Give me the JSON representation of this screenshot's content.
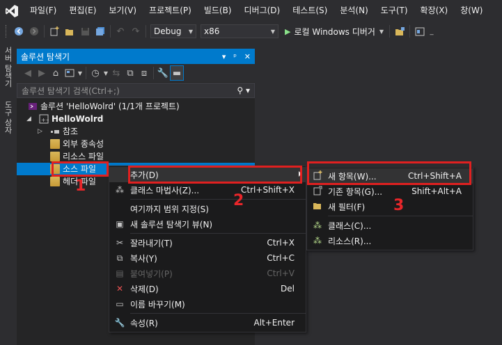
{
  "menubar": {
    "items": [
      "파일(F)",
      "편집(E)",
      "보기(V)",
      "프로젝트(P)",
      "빌드(B)",
      "디버그(D)",
      "테스트(S)",
      "분석(N)",
      "도구(T)",
      "확장(X)",
      "창(W)"
    ]
  },
  "toolbar": {
    "config": "Debug",
    "platform": "x86",
    "run_label": "로컬 Windows 디버거"
  },
  "left_strip": {
    "tabs": [
      "서버 탐색기",
      "도구 상자"
    ]
  },
  "solution_explorer": {
    "title": "솔루션 탐색기",
    "search_placeholder": "솔루션 탐색기 검색(Ctrl+;)",
    "tree": {
      "solution": "솔루션 'HelloWolrd' (1/1개 프로젝트)",
      "project": "HelloWolrd",
      "references": "참조",
      "external_deps": "외부 종속성",
      "resource_files": "리소스 파일",
      "source_files": "소스 파일",
      "header_files": "헤더 파일"
    }
  },
  "context_menu": {
    "items": [
      {
        "label": "추가(D)",
        "shortcut": ""
      },
      {
        "label": "클래스 마법사(Z)...",
        "shortcut": "Ctrl+Shift+X"
      },
      {
        "label": "여기까지 범위 지정(S)",
        "shortcut": ""
      },
      {
        "label": "새 솔루션 탐색기 뷰(N)",
        "shortcut": ""
      },
      {
        "label": "잘라내기(T)",
        "shortcut": "Ctrl+X"
      },
      {
        "label": "복사(Y)",
        "shortcut": "Ctrl+C"
      },
      {
        "label": "붙여넣기(P)",
        "shortcut": "Ctrl+V"
      },
      {
        "label": "삭제(D)",
        "shortcut": "Del"
      },
      {
        "label": "이름 바꾸기(M)",
        "shortcut": ""
      },
      {
        "label": "속성(R)",
        "shortcut": "Alt+Enter"
      }
    ]
  },
  "submenu": {
    "items": [
      {
        "label": "새 항목(W)...",
        "shortcut": "Ctrl+Shift+A"
      },
      {
        "label": "기존 항목(G)...",
        "shortcut": "Shift+Alt+A"
      },
      {
        "label": "새 필터(F)",
        "shortcut": ""
      },
      {
        "label": "클래스(C)...",
        "shortcut": ""
      },
      {
        "label": "리소스(R)...",
        "shortcut": ""
      }
    ]
  },
  "annotations": {
    "step1": "1",
    "step2": "2",
    "step3": "3"
  },
  "colors": {
    "accent": "#007acc",
    "annotation_red": "#e02020"
  }
}
